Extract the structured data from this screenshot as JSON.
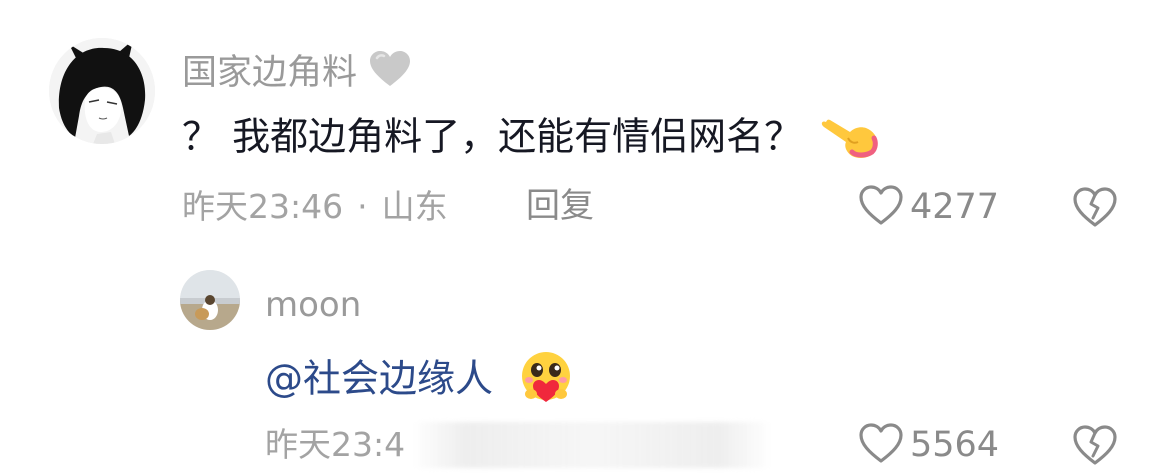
{
  "comments": [
    {
      "username": "国家边角料",
      "text": "？ 我都边角料了，还能有情侣网名？",
      "time": "昨天23:46",
      "separator": "·",
      "location": "山东",
      "reply_label": "回复",
      "like_count": "4277"
    },
    {
      "username": "moon",
      "mention": "@社会边缘人",
      "time": "昨天23:4",
      "like_count": "5564"
    }
  ],
  "icons": {
    "like": "heart-outline-icon",
    "dislike": "broken-heart-icon",
    "user1_badge": "grey-heart-icon",
    "emoji1": "pointing-hand-emoji",
    "emoji2": "heart-hug-emoji"
  },
  "colors": {
    "username": "#9a9a9a",
    "text": "#161823",
    "mention": "#2c4a8a",
    "meta": "#a3a3a3"
  }
}
